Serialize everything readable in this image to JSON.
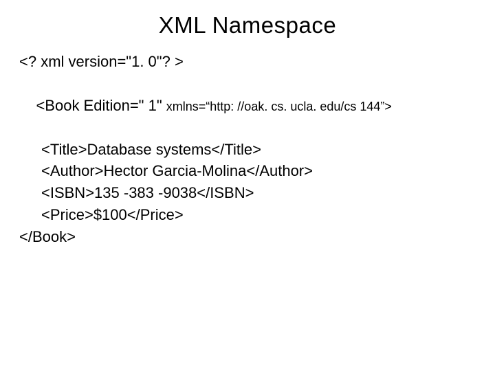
{
  "title": "XML Namespace",
  "xml": {
    "line1": "<? xml version=\"1. 0\"? >",
    "line2_pre": "<Book Edition=\" 1\" ",
    "line2_attr": "xmlns=“http: //oak. cs. ucla. edu/cs 144”>",
    "line3": "<Title>Database systems</Title>",
    "line4": "<Author>Hector Garcia-Molina</Author>",
    "line5": "<ISBN>135 -383 -9038</ISBN>",
    "line6": "<Price>$100</Price>",
    "line7": "</Book>"
  }
}
